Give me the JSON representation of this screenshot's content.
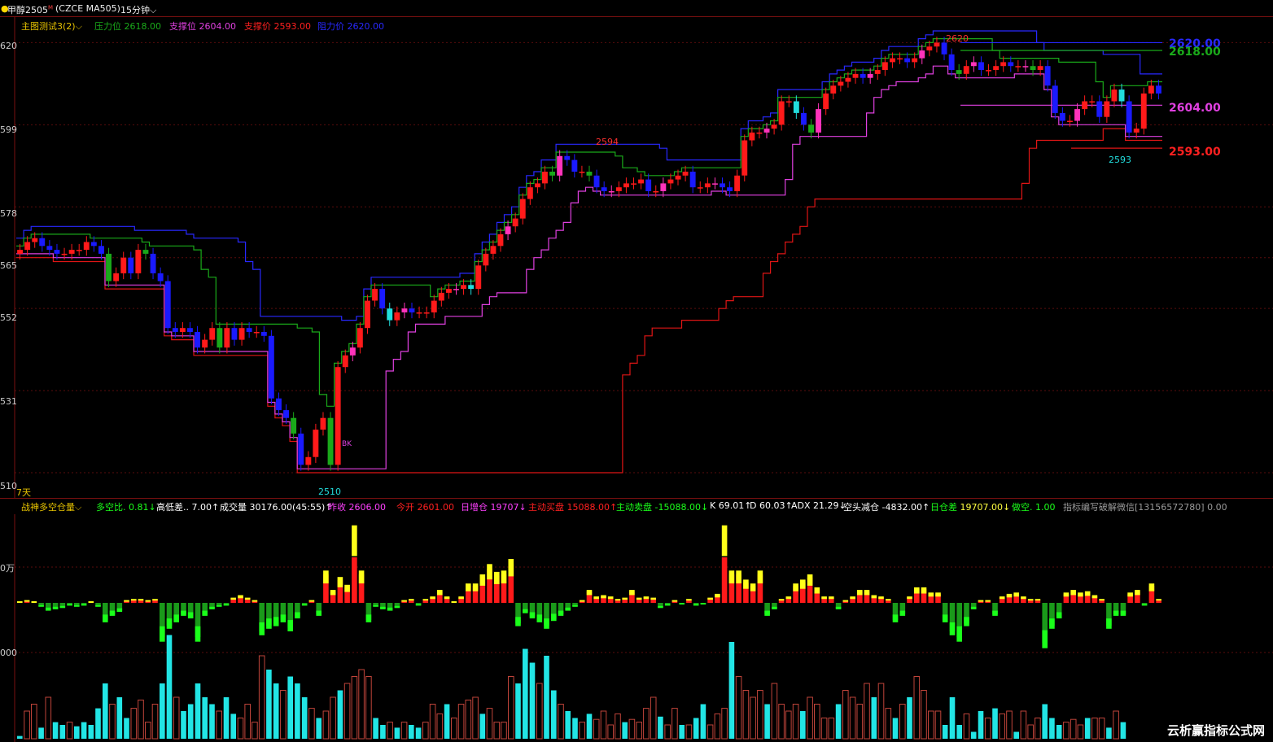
{
  "header": {
    "symbol": "甲醇2505",
    "symbol_sup": "M",
    "contract": "(CZCE MA505)",
    "period": "15分钟"
  },
  "main_legend": {
    "indicator": "主图测试3(2)",
    "items": [
      {
        "label": "压力位",
        "value": "2618.00",
        "color": "#1aaa1a"
      },
      {
        "label": "支撑位",
        "value": "2604.00",
        "color": "#e040e0"
      },
      {
        "label": "支撑价",
        "value": "2593.00",
        "color": "#ff2020"
      },
      {
        "label": "阻力价",
        "value": "2620.00",
        "color": "#2828ff"
      }
    ]
  },
  "main_axis_labels": [
    "620",
    "599",
    "578",
    "565",
    "552",
    "531",
    "510"
  ],
  "days_label": "7天",
  "level_labels": {
    "resist_price": "2620.00",
    "pressure": "2618.00",
    "support": "2604.00",
    "support_price": "2593.00"
  },
  "price_annotations": {
    "high_2620": "2620",
    "high_2594": "2594",
    "low_2510": "2510",
    "low_2593": "2593",
    "bk_mark": "BK"
  },
  "sub_legend": {
    "indicator": "战神多空仓量",
    "items": [
      {
        "label": "多空比.",
        "value": "0.81↓",
        "color": "#1aff1a"
      },
      {
        "label": "高低差..",
        "value": "7.00↑",
        "color": "#ffffff"
      },
      {
        "label": "成交量",
        "value": "30176.00(45:55)↑",
        "color": "#ffffff"
      },
      {
        "label": "昨收",
        "value": "2606.00",
        "color": "#ff40ff"
      },
      {
        "label": "今开",
        "value": "2601.00",
        "color": "#ff2020"
      },
      {
        "label": "日增仓",
        "value": "19707↓",
        "color": "#ff40ff"
      },
      {
        "label": "主动买盘",
        "value": "15088.00↑",
        "color": "#ff2020"
      },
      {
        "label": "主动卖盘",
        "value": "-15088.00↓",
        "color": "#1aff1a"
      },
      {
        "label": "K",
        "value": "69.01↑",
        "color": "#ffffff"
      },
      {
        "label": "D",
        "value": "60.03↑",
        "color": "#ffffff"
      },
      {
        "label": "ADX",
        "value": "21.29↓",
        "color": "#ffffff"
      },
      {
        "label": "空头减仓",
        "value": "-4832.00↑",
        "color": "#ffffff"
      },
      {
        "label": "日仓差",
        "value": "19707.00↓",
        "color": "#ffff40"
      },
      {
        "label": "做空.",
        "value": "1.00",
        "color": "#1aff1a"
      },
      {
        "label": "指标编写破解微信[13156572780]",
        "value": "0.00",
        "color": "#9a9a9a"
      }
    ]
  },
  "sub_axis_labels": [
    "0万",
    "000"
  ],
  "watermark": "云析赢指标公式网",
  "chart_data": [
    {
      "type": "candlestick",
      "title": "",
      "ylim": [
        2505,
        2623
      ],
      "levels": {
        "resist_price": 2620,
        "pressure": 2618,
        "support": 2604,
        "support_price": 2593
      },
      "candle_colors": [
        "#ff1a1a",
        "#1a1aff",
        "#1aa81a",
        "#ff33bb",
        "#22dddd"
      ],
      "close_approx": [
        2567,
        2569,
        2570,
        2568,
        2567,
        2566,
        2566,
        2567,
        2567,
        2569,
        2568,
        2566,
        2559,
        2561,
        2565,
        2561,
        2567,
        2566,
        2561,
        2559,
        2547,
        2546,
        2547,
        2546,
        2542,
        2544,
        2547,
        2542,
        2547,
        2544,
        2547,
        2546,
        2546,
        2545,
        2529,
        2526,
        2524,
        2520,
        2512,
        2514,
        2521,
        2524,
        2512,
        2537,
        2540,
        2542,
        2547,
        2554,
        2557,
        2552,
        2549,
        2551,
        2552,
        2551,
        2551,
        2551,
        2554,
        2556,
        2557,
        2557,
        2558,
        2557,
        2563,
        2566,
        2568,
        2571,
        2573,
        2575,
        2580,
        2583,
        2584,
        2587,
        2586,
        2591,
        2590,
        2587,
        2587,
        2586,
        2583,
        2582,
        2582,
        2583,
        2584,
        2584,
        2585,
        2582,
        2582,
        2584,
        2585,
        2586,
        2587,
        2583,
        2583,
        2584,
        2584,
        2583,
        2582,
        2586,
        2595,
        2597,
        2597,
        2598,
        2599,
        2605,
        2605,
        2602,
        2599,
        2597,
        2603,
        2607,
        2609,
        2610,
        2611,
        2612,
        2611,
        2612,
        2613,
        2615,
        2616,
        2616,
        2615,
        2616,
        2618,
        2619,
        2620,
        2617,
        2613,
        2612,
        2614,
        2615,
        2613,
        2613,
        2614,
        2615,
        2614,
        2614,
        2614,
        2613,
        2614,
        2609,
        2602,
        2600,
        2600,
        2603,
        2605,
        2605,
        2601,
        2605,
        2608,
        2605,
        2597,
        2598,
        2607,
        2609,
        2607
      ]
    },
    {
      "type": "bar",
      "title": "",
      "ylim": [
        -35,
        85
      ],
      "position_change": [
        1,
        2,
        1,
        -3,
        -6,
        -5,
        -4,
        -2,
        -3,
        -2,
        1,
        -3,
        -15,
        -10,
        -7,
        2,
        3,
        3,
        2,
        3,
        -30,
        -20,
        -15,
        -10,
        -12,
        -30,
        -10,
        -5,
        -3,
        -2,
        4,
        6,
        4,
        2,
        -25,
        -20,
        -18,
        -15,
        -22,
        -12,
        -2,
        2,
        -10,
        25,
        10,
        20,
        14,
        60,
        25,
        -15,
        -3,
        -5,
        -6,
        -4,
        2,
        3,
        -2,
        3,
        5,
        10,
        5,
        1,
        5,
        15,
        15,
        22,
        30,
        24,
        25,
        34,
        -18,
        -8,
        -12,
        -15,
        -20,
        -14,
        -10,
        -6,
        -3,
        2,
        10,
        5,
        6,
        5,
        3,
        4,
        10,
        4,
        5,
        4,
        -4,
        -2,
        2,
        -1,
        3,
        -2,
        -1,
        4,
        7,
        60,
        25,
        25,
        18,
        15,
        25,
        -10,
        -5,
        3,
        5,
        15,
        18,
        22,
        12,
        5,
        5,
        -5,
        2,
        5,
        10,
        10,
        6,
        5,
        3,
        -15,
        -10,
        5,
        12,
        12,
        8,
        8,
        -15,
        -25,
        -30,
        -18,
        -5,
        2,
        2,
        -10,
        5,
        7,
        8,
        5,
        3,
        3,
        -35,
        -20,
        -12,
        8,
        10,
        8,
        9,
        6,
        3,
        -20,
        -10,
        -10,
        8,
        10,
        -2,
        15,
        3
      ],
      "volume": [
        2,
        20,
        25,
        8,
        30,
        12,
        10,
        12,
        9,
        12,
        10,
        22,
        40,
        25,
        30,
        15,
        22,
        28,
        12,
        25,
        40,
        75,
        30,
        20,
        25,
        40,
        30,
        25,
        20,
        30,
        18,
        15,
        25,
        12,
        60,
        50,
        40,
        35,
        45,
        40,
        30,
        22,
        15,
        20,
        30,
        35,
        40,
        45,
        50,
        45,
        15,
        10,
        12,
        8,
        12,
        10,
        8,
        12,
        25,
        18,
        25,
        15,
        25,
        28,
        30,
        18,
        22,
        12,
        12,
        45,
        40,
        65,
        55,
        40,
        60,
        35,
        25,
        20,
        15,
        12,
        18,
        14,
        20,
        10,
        18,
        12,
        14,
        12,
        22,
        30,
        16,
        10,
        22,
        10,
        10,
        15,
        25,
        10,
        18,
        22,
        70,
        45,
        35,
        30,
        35,
        25,
        40,
        25,
        20,
        25,
        20,
        30,
        25,
        15,
        15,
        25,
        35,
        30,
        25,
        40,
        30,
        40,
        22,
        15,
        25,
        30,
        45,
        35,
        20,
        20,
        10,
        30,
        10,
        18,
        5,
        20,
        15,
        22,
        18,
        20,
        5,
        20,
        10,
        15,
        25,
        15,
        10,
        12,
        14,
        10,
        15,
        15,
        15,
        8,
        20,
        12
      ]
    }
  ]
}
